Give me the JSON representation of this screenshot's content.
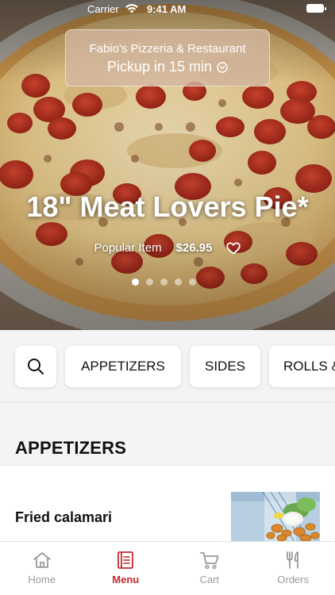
{
  "status_bar": {
    "carrier": "Carrier",
    "time": "9:41 AM"
  },
  "store": {
    "name": "Fabio's Pizzeria & Restaurant",
    "pickup": "Pickup in 15 min"
  },
  "hero": {
    "title": "18\" Meat Lovers Pie*",
    "tag": "Popular Item",
    "price": "$26.95",
    "slide_count": 5,
    "active_slide": 0
  },
  "search_icon": "search-icon",
  "categories": [
    "APPETIZERS",
    "SIDES",
    "ROLLS &"
  ],
  "section": {
    "title": "APPETIZERS"
  },
  "items": [
    {
      "name": "Fried calamari"
    }
  ],
  "tabs": [
    {
      "label": "Home",
      "icon": "home-icon",
      "active": false
    },
    {
      "label": "Menu",
      "icon": "menu-icon",
      "active": true
    },
    {
      "label": "Cart",
      "icon": "cart-icon",
      "active": false
    },
    {
      "label": "Orders",
      "icon": "fork-knife-icon",
      "active": false
    }
  ],
  "colors": {
    "accent": "#c8272d",
    "inactive_tab": "#9a9a9a",
    "background": "#f4f4f4"
  }
}
